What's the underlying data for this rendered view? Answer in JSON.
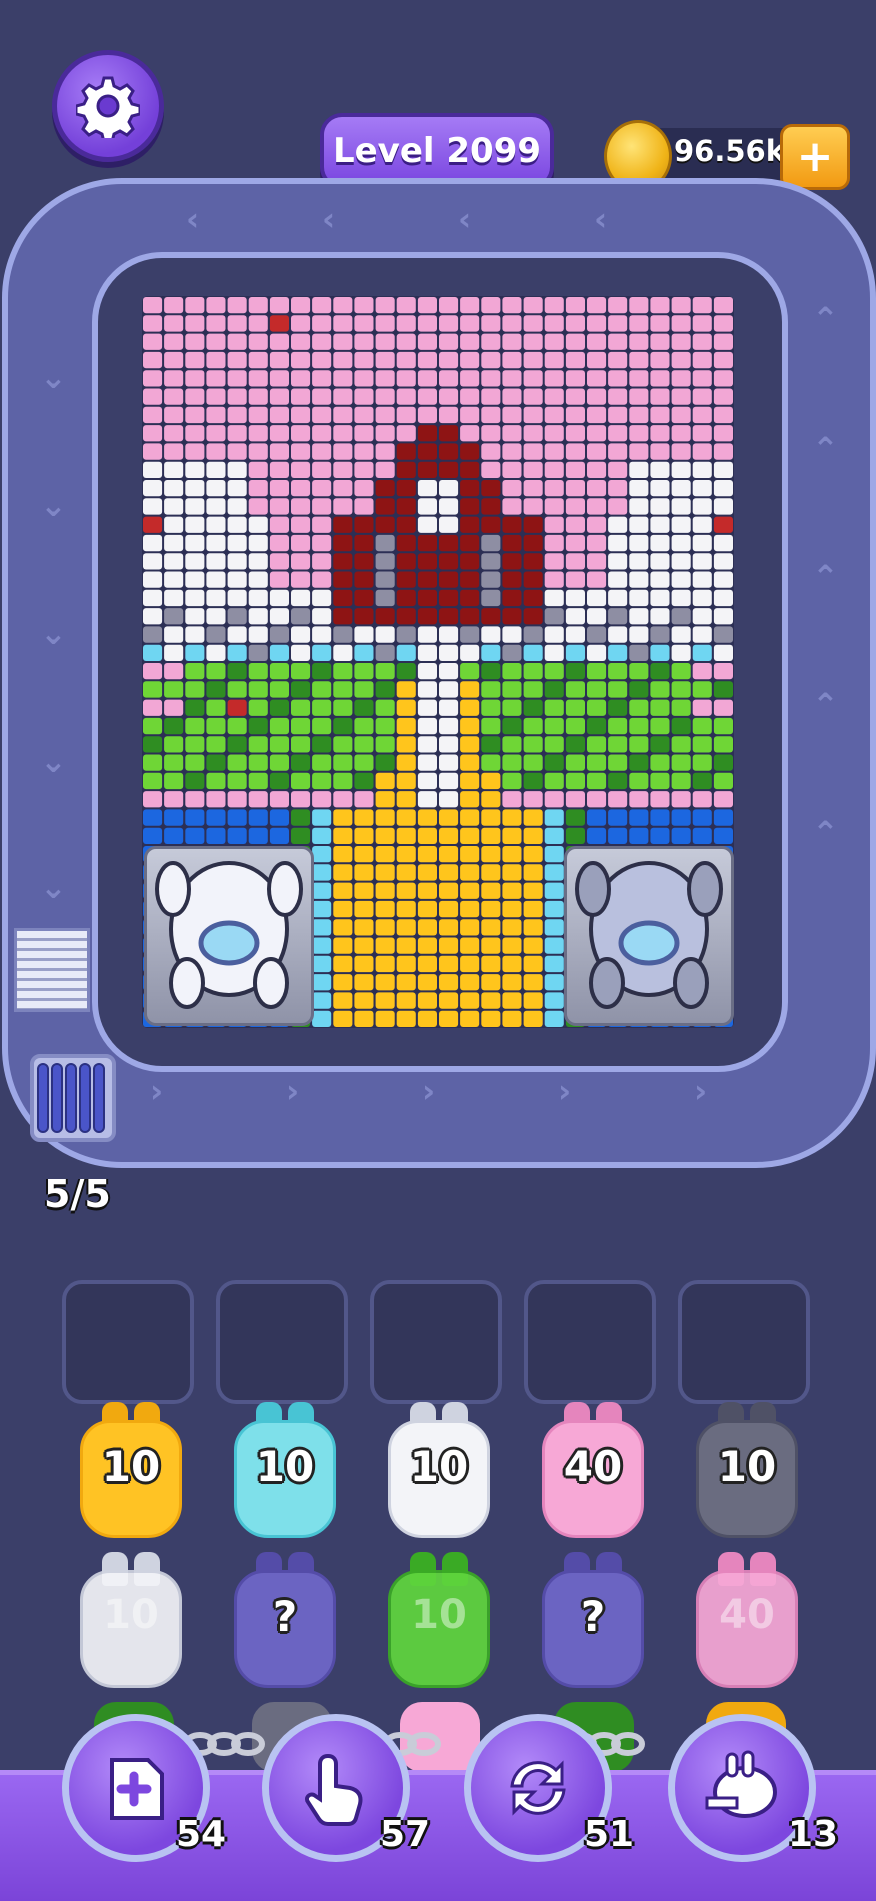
{
  "header": {
    "level_label": "Level 2099",
    "coins": "96.56k"
  },
  "colors": {
    "background": "#3b3f69",
    "accent_purple": "#7a46e0",
    "coin_gold": "#f0b418",
    "track": "#9ea8e6"
  },
  "conveyor": {
    "capacity_label": "5/5"
  },
  "board": {
    "palette": {
      "P": "#f2a7d5",
      "W": "#f4f4f7",
      "R": "#8e1414",
      "G": "#8e8ea3",
      "g": "#6fd636",
      "d": "#2f8d22",
      "Y": "#ffc51c",
      "C": "#6fd6f2",
      "B": "#1c67e0",
      "X": "#c42a2a"
    }
  },
  "slots": [
    "",
    "",
    "",
    "",
    ""
  ],
  "bunnies_row1": [
    {
      "color": "#ffc324",
      "ear": "#f1a90f",
      "count": "10"
    },
    {
      "color": "#7ee0ea",
      "ear": "#48c4d4",
      "count": "10"
    },
    {
      "color": "#f3f4f8",
      "ear": "#cfd3e0",
      "count": "10"
    },
    {
      "color": "#f7a8d6",
      "ear": "#e585bd",
      "count": "40"
    },
    {
      "color": "#6a6c80",
      "ear": "#4f5166",
      "count": "10"
    }
  ],
  "bunnies_row2": [
    {
      "color": "#f3f4f8",
      "ear": "#cfd3e0",
      "count": "10",
      "faded": true
    },
    {
      "color": "#6b64c2",
      "ear": "#544ca8",
      "count": "?",
      "mystery": true
    },
    {
      "color": "#5fd63d",
      "ear": "#3aaa25",
      "count": "10",
      "faded": true
    },
    {
      "color": "#6b64c2",
      "ear": "#544ca8",
      "count": "?",
      "mystery": true
    },
    {
      "color": "#f7a8d6",
      "ear": "#e585bd",
      "count": "40",
      "faded": true
    }
  ],
  "powerups": [
    {
      "icon": "add-cup-icon",
      "count": "54"
    },
    {
      "icon": "tap-hand-icon",
      "count": "57"
    },
    {
      "icon": "shuffle-icon",
      "count": "51"
    },
    {
      "icon": "bunny-helmet-icon",
      "count": "13"
    }
  ]
}
